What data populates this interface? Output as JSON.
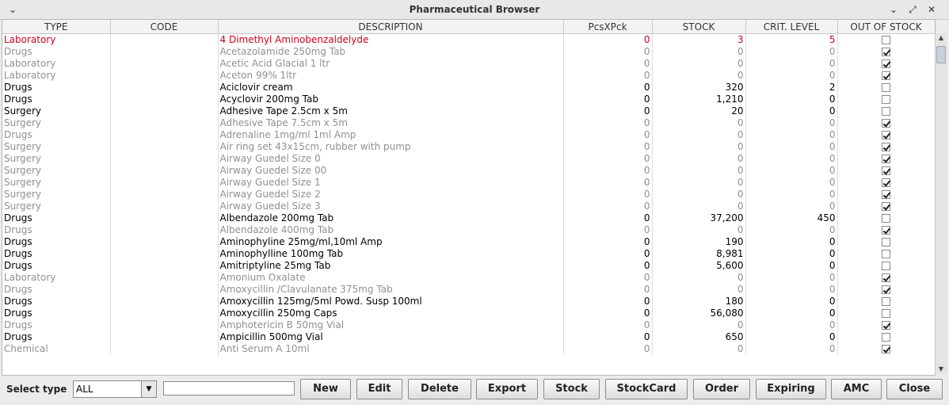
{
  "window": {
    "title": "Pharmaceutical Browser",
    "menu_glyph": "⌄",
    "minimize_glyph": "⌄",
    "maximize_glyph": "⤢",
    "close_glyph": "✕"
  },
  "columns": [
    "TYPE",
    "CODE",
    "DESCRIPTION",
    "PcsXPck",
    "STOCK",
    "CRIT. LEVEL",
    "OUT OF STOCK"
  ],
  "row_status_colors": {
    "active": "#000000",
    "out_of_stock": "#909090",
    "critical": "#d0021b"
  },
  "rows": [
    {
      "type": "Laboratory",
      "code": "",
      "description": "4 Dimethyl Aminobenzaldelyde",
      "pcs": "0",
      "stock": "3",
      "crit": "5",
      "out_of_stock": false,
      "status": "crit"
    },
    {
      "type": "Drugs",
      "code": "",
      "description": "Acetazolamide 250mg Tab",
      "pcs": "0",
      "stock": "0",
      "crit": "0",
      "out_of_stock": true,
      "status": "out"
    },
    {
      "type": "Laboratory",
      "code": "",
      "description": "Acetic Acid Glacial 1 ltr",
      "pcs": "0",
      "stock": "0",
      "crit": "0",
      "out_of_stock": true,
      "status": "out"
    },
    {
      "type": "Laboratory",
      "code": "",
      "description": "Aceton 99% 1ltr",
      "pcs": "0",
      "stock": "0",
      "crit": "0",
      "out_of_stock": true,
      "status": "out"
    },
    {
      "type": "Drugs",
      "code": "",
      "description": "Aciclovir cream",
      "pcs": "0",
      "stock": "320",
      "crit": "2",
      "out_of_stock": false,
      "status": "active"
    },
    {
      "type": "Drugs",
      "code": "",
      "description": "Acyclovir 200mg Tab",
      "pcs": "0",
      "stock": "1,210",
      "crit": "0",
      "out_of_stock": false,
      "status": "active"
    },
    {
      "type": "Surgery",
      "code": "",
      "description": "Adhesive Tape 2.5cm x 5m",
      "pcs": "0",
      "stock": "20",
      "crit": "0",
      "out_of_stock": false,
      "status": "active"
    },
    {
      "type": "Surgery",
      "code": "",
      "description": "Adhesive Tape 7.5cm x 5m",
      "pcs": "0",
      "stock": "0",
      "crit": "0",
      "out_of_stock": true,
      "status": "out"
    },
    {
      "type": "Drugs",
      "code": "",
      "description": "Adrenaline 1mg/ml 1ml Amp",
      "pcs": "0",
      "stock": "0",
      "crit": "0",
      "out_of_stock": true,
      "status": "out"
    },
    {
      "type": "Surgery",
      "code": "",
      "description": "Air ring set 43x15cm, rubber with pump",
      "pcs": "0",
      "stock": "0",
      "crit": "0",
      "out_of_stock": true,
      "status": "out"
    },
    {
      "type": "Surgery",
      "code": "",
      "description": "Airway Guedel Size 0",
      "pcs": "0",
      "stock": "0",
      "crit": "0",
      "out_of_stock": true,
      "status": "out"
    },
    {
      "type": "Surgery",
      "code": "",
      "description": "Airway Guedel Size 00",
      "pcs": "0",
      "stock": "0",
      "crit": "0",
      "out_of_stock": true,
      "status": "out"
    },
    {
      "type": "Surgery",
      "code": "",
      "description": "Airway Guedel Size 1",
      "pcs": "0",
      "stock": "0",
      "crit": "0",
      "out_of_stock": true,
      "status": "out"
    },
    {
      "type": "Surgery",
      "code": "",
      "description": "Airway Guedel Size 2",
      "pcs": "0",
      "stock": "0",
      "crit": "0",
      "out_of_stock": true,
      "status": "out"
    },
    {
      "type": "Surgery",
      "code": "",
      "description": "Airway Guedel Size 3",
      "pcs": "0",
      "stock": "0",
      "crit": "0",
      "out_of_stock": true,
      "status": "out"
    },
    {
      "type": "Drugs",
      "code": "",
      "description": "Albendazole 200mg Tab",
      "pcs": "0",
      "stock": "37,200",
      "crit": "450",
      "out_of_stock": false,
      "status": "active"
    },
    {
      "type": "Drugs",
      "code": "",
      "description": "Albendazole 400mg Tab",
      "pcs": "0",
      "stock": "0",
      "crit": "0",
      "out_of_stock": true,
      "status": "out"
    },
    {
      "type": "Drugs",
      "code": "",
      "description": "Aminophyline 25mg/ml,10ml Amp",
      "pcs": "0",
      "stock": "190",
      "crit": "0",
      "out_of_stock": false,
      "status": "active"
    },
    {
      "type": "Drugs",
      "code": "",
      "description": "Aminophylline 100mg Tab",
      "pcs": "0",
      "stock": "8,981",
      "crit": "0",
      "out_of_stock": false,
      "status": "active"
    },
    {
      "type": "Drugs",
      "code": "",
      "description": "Amitriptyline 25mg Tab",
      "pcs": "0",
      "stock": "5,600",
      "crit": "0",
      "out_of_stock": false,
      "status": "active"
    },
    {
      "type": "Laboratory",
      "code": "",
      "description": "Amonium Oxalate",
      "pcs": "0",
      "stock": "0",
      "crit": "0",
      "out_of_stock": true,
      "status": "out"
    },
    {
      "type": "Drugs",
      "code": "",
      "description": "Amoxycillin /Clavulanate 375mg Tab",
      "pcs": "0",
      "stock": "0",
      "crit": "0",
      "out_of_stock": true,
      "status": "out"
    },
    {
      "type": "Drugs",
      "code": "",
      "description": "Amoxycillin 125mg/5ml Powd. Susp 100ml",
      "pcs": "0",
      "stock": "180",
      "crit": "0",
      "out_of_stock": false,
      "status": "active"
    },
    {
      "type": "Drugs",
      "code": "",
      "description": "Amoxycillin 250mg Caps",
      "pcs": "0",
      "stock": "56,080",
      "crit": "0",
      "out_of_stock": false,
      "status": "active"
    },
    {
      "type": "Drugs",
      "code": "",
      "description": "Amphotericin B 50mg Vial",
      "pcs": "0",
      "stock": "0",
      "crit": "0",
      "out_of_stock": true,
      "status": "out"
    },
    {
      "type": "Drugs",
      "code": "",
      "description": "Ampicillin 500mg Vial",
      "pcs": "0",
      "stock": "650",
      "crit": "0",
      "out_of_stock": false,
      "status": "active"
    },
    {
      "type": "Chemical",
      "code": "",
      "description": "Anti Serum A 10ml",
      "pcs": "0",
      "stock": "0",
      "crit": "0",
      "out_of_stock": true,
      "status": "out"
    }
  ],
  "toolbar": {
    "select_type_label": "Select type",
    "select_type_value": "ALL",
    "search_value": "",
    "buttons": [
      "New",
      "Edit",
      "Delete",
      "Export",
      "Stock",
      "StockCard",
      "Order",
      "Expiring",
      "AMC",
      "Close"
    ]
  }
}
